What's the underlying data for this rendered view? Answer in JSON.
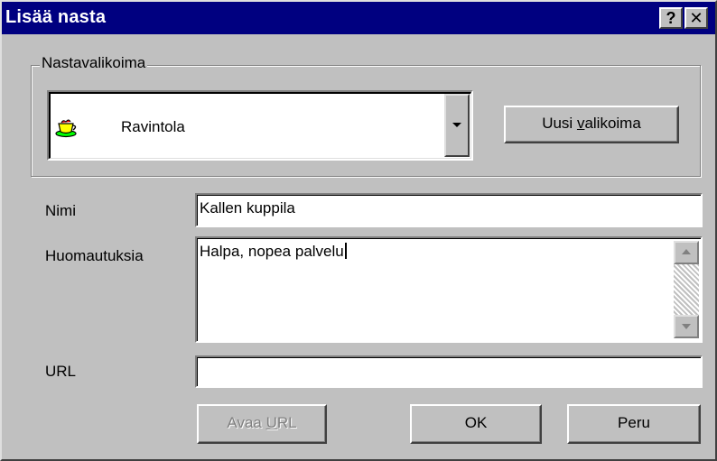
{
  "window": {
    "title": "Lisää nasta",
    "help_glyph": "?",
    "close_glyph": "✕"
  },
  "group": {
    "legend": "Nastavalikoima",
    "selected_category": "Ravintola",
    "category_icon": "restaurant-cup-icon",
    "new_set_prefix": "Uusi ",
    "new_set_accel": "v",
    "new_set_suffix": "alikoima"
  },
  "form": {
    "name_label": "Nimi",
    "name_value": "Kallen kuppila",
    "notes_label": "Huomautuksia",
    "notes_value": "Halpa, nopea palvelu",
    "url_label": "URL",
    "url_value": ""
  },
  "buttons": {
    "open_prefix": "Avaa ",
    "open_accel": "U",
    "open_suffix": "RL",
    "ok": "OK",
    "cancel": "Peru"
  },
  "colors": {
    "titlebar": "#000080",
    "face": "#c0c0c0",
    "disabled_text": "#808080"
  }
}
